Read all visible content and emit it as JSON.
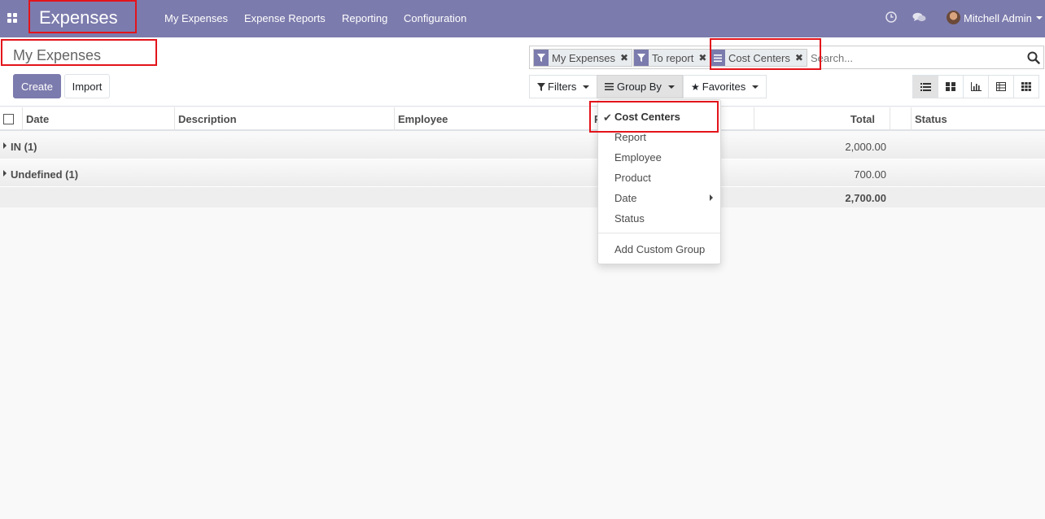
{
  "navbar": {
    "brand": "Expenses",
    "menu": [
      "My Expenses",
      "Expense Reports",
      "Reporting",
      "Configuration"
    ],
    "user_name": "Mitchell Admin",
    "icons": [
      "apps-icon",
      "clock-icon",
      "chat-icon",
      "avatar",
      "caret-down-icon"
    ]
  },
  "control_panel": {
    "title": "My Expenses",
    "create_label": "Create",
    "import_label": "Import"
  },
  "search": {
    "facets": [
      {
        "label": "My Expenses",
        "icon": "filter-icon"
      },
      {
        "label": "To report",
        "icon": "filter-icon"
      },
      {
        "label": "Cost Centers",
        "icon": "group-by-icon"
      }
    ],
    "placeholder": "Search..."
  },
  "toolbar": {
    "filters_label": "Filters",
    "groupby_label": "Group By",
    "favorites_label": "Favorites"
  },
  "views": [
    "list-view-icon",
    "kanban-view-icon",
    "graph-view-icon",
    "pivot-view-icon",
    "grid-view-icon"
  ],
  "table": {
    "columns": [
      "Date",
      "Description",
      "Employee",
      "P",
      "Total",
      "Status"
    ],
    "groups": [
      {
        "label": "IN (1)",
        "total": "2,000.00"
      },
      {
        "label": "Undefined (1)",
        "total": "700.00"
      }
    ],
    "grand_total": "2,700.00"
  },
  "groupby_menu": {
    "items": [
      "Cost Centers",
      "Report",
      "Employee",
      "Product",
      "Date",
      "Status"
    ],
    "selected": "Cost Centers",
    "custom_label": "Add Custom Group"
  },
  "colors": {
    "brand": "#7c7bad",
    "highlight": "#e3141b"
  }
}
